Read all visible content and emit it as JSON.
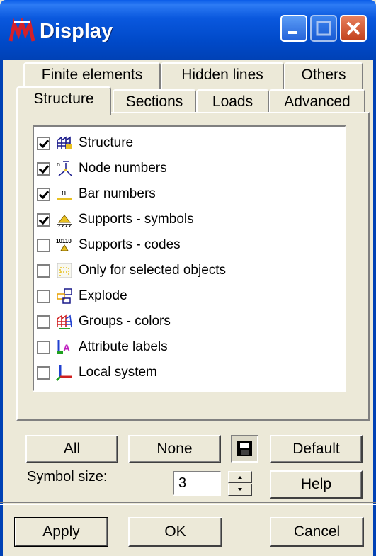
{
  "window": {
    "title": "Display"
  },
  "tabs": {
    "row1": [
      "Finite elements",
      "Hidden lines",
      "Others"
    ],
    "row2": [
      "Structure",
      "Sections",
      "Loads",
      "Advanced"
    ],
    "active": "Structure"
  },
  "items": [
    {
      "label": "Structure",
      "checked": true,
      "icon": "structure-icon"
    },
    {
      "label": "Node numbers",
      "checked": true,
      "icon": "node-numbers-icon"
    },
    {
      "label": "Bar numbers",
      "checked": true,
      "icon": "bar-numbers-icon"
    },
    {
      "label": "Supports - symbols",
      "checked": true,
      "icon": "supports-symbols-icon"
    },
    {
      "label": "Supports - codes",
      "checked": false,
      "icon": "supports-codes-icon"
    },
    {
      "label": "Only for selected objects",
      "checked": false,
      "icon": "selected-objects-icon"
    },
    {
      "label": "Explode",
      "checked": false,
      "icon": "explode-icon"
    },
    {
      "label": "Groups - colors",
      "checked": false,
      "icon": "groups-colors-icon"
    },
    {
      "label": "Attribute labels",
      "checked": false,
      "icon": "attribute-labels-icon"
    },
    {
      "label": "Local system",
      "checked": false,
      "icon": "local-system-icon"
    }
  ],
  "buttons": {
    "all": "All",
    "none": "None",
    "default": "Default",
    "help": "Help",
    "apply": "Apply",
    "ok": "OK",
    "cancel": "Cancel"
  },
  "symbol_size": {
    "label": "Symbol size:",
    "value": "3"
  },
  "colors": {
    "titlebar": "#0a58de",
    "close": "#c2411d",
    "face": "#ece9d8"
  }
}
